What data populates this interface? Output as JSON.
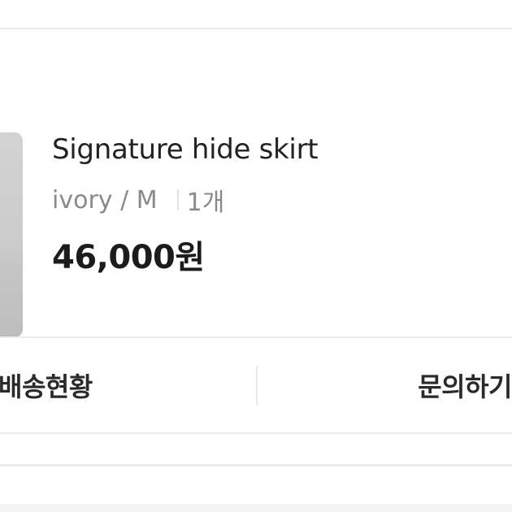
{
  "product": {
    "name": "Signature hide skirt",
    "option": "ivory / M",
    "quantity": "1개",
    "price": "46,000원"
  },
  "actions": {
    "shipping_status_label": "배송현황",
    "inquiry_label": "문의하기"
  }
}
